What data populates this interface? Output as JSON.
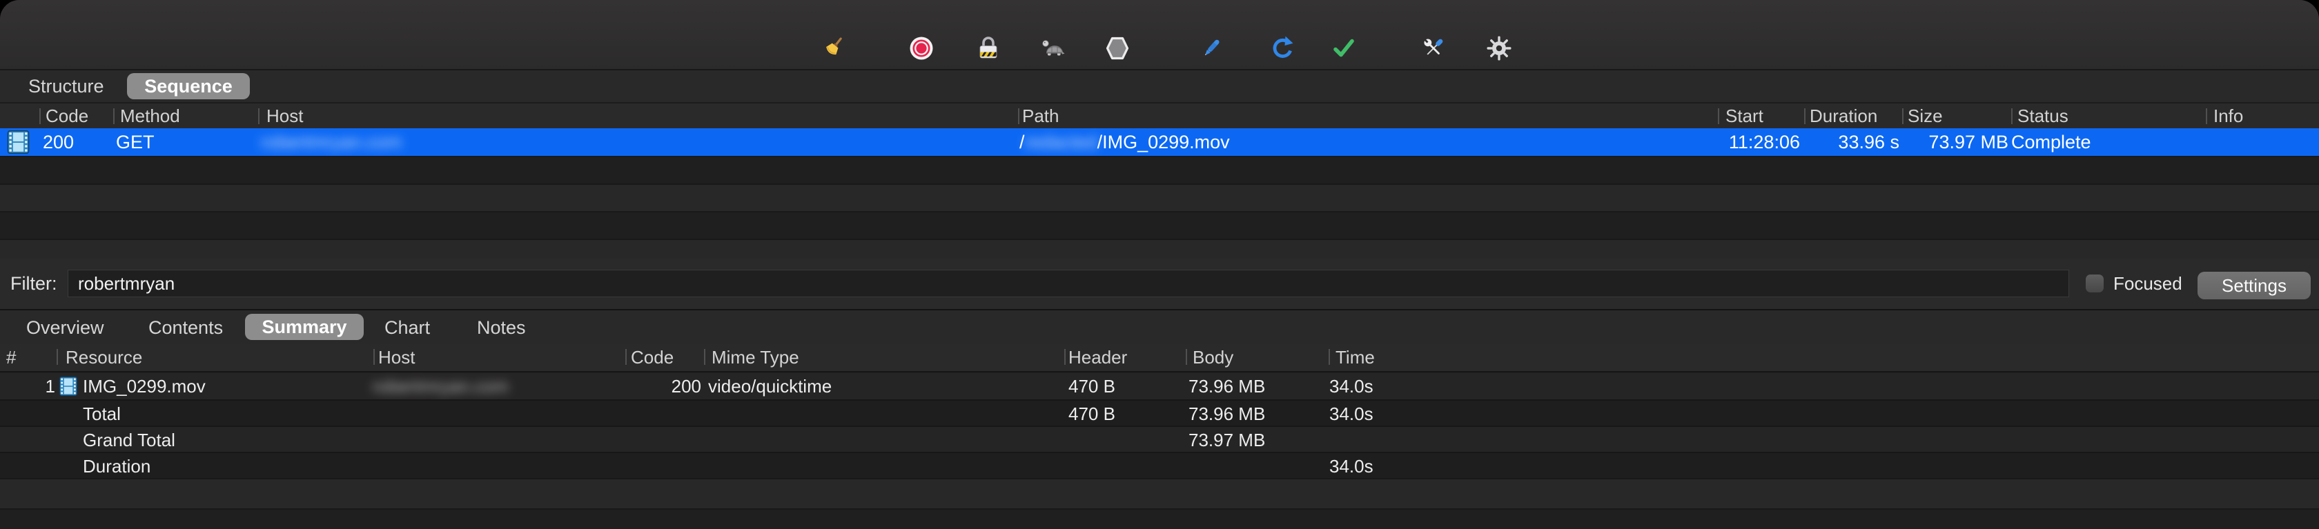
{
  "colors": {
    "selection_blue": "#0c68f3",
    "pill_gray": "#8d8d8d",
    "toolbar_bg": "#2f2e2e",
    "stripe_dark": "#201f1f",
    "stripe_light": "#292828"
  },
  "toolbar": {
    "icons": [
      {
        "name": "clear-broom"
      },
      {
        "name": "record"
      },
      {
        "name": "ssl-proxying-lock"
      },
      {
        "name": "throttle-turtle"
      },
      {
        "name": "breakpoints-hexagon"
      },
      {
        "name": "compose-pen"
      },
      {
        "name": "repeat"
      },
      {
        "name": "validate-check"
      },
      {
        "name": "tools"
      },
      {
        "name": "settings-gear"
      }
    ]
  },
  "sequence_panel": {
    "tabs": [
      {
        "label": "Structure",
        "selected": false
      },
      {
        "label": "Sequence",
        "selected": true
      }
    ],
    "columns": [
      "Code",
      "Method",
      "Host",
      "Path",
      "Start",
      "Duration",
      "Size",
      "Status",
      "Info"
    ],
    "row": {
      "code": "200",
      "method": "GET",
      "host": "robertmryan.com",
      "host_redacted": true,
      "path_prefix": "/",
      "path_redacted": "redacted",
      "path_suffix": "/IMG_0299.mov",
      "start": "11:28:06",
      "duration": "33.96 s",
      "size": "73.97 MB",
      "status": "Complete",
      "info": ""
    }
  },
  "filter_bar": {
    "label": "Filter:",
    "value": "robertmryan",
    "focused_label": "Focused",
    "focused_checked": false,
    "settings_label": "Settings"
  },
  "detail_panel": {
    "tabs": [
      {
        "label": "Overview",
        "selected": false
      },
      {
        "label": "Contents",
        "selected": false
      },
      {
        "label": "Summary",
        "selected": true
      },
      {
        "label": "Chart",
        "selected": false
      },
      {
        "label": "Notes",
        "selected": false
      }
    ],
    "summary_table": {
      "columns": [
        "#",
        "Resource",
        "Host",
        "Code",
        "Mime Type",
        "Header",
        "Body",
        "Time"
      ],
      "rows": [
        {
          "num": "1",
          "resource": "IMG_0299.mov",
          "host": "robertmryan.com",
          "host_redacted": true,
          "code": "200",
          "mime_type": "video/quicktime",
          "header": "470 B",
          "body": "73.96 MB",
          "time": "34.0s"
        },
        {
          "num": "",
          "resource": "Total",
          "host": "",
          "code": "",
          "mime_type": "",
          "header": "470 B",
          "body": "73.96 MB",
          "time": "34.0s"
        },
        {
          "num": "",
          "resource": "Grand Total",
          "host": "",
          "code": "",
          "mime_type": "",
          "header": "",
          "body": "73.97 MB",
          "time": ""
        },
        {
          "num": "",
          "resource": "Duration",
          "host": "",
          "code": "",
          "mime_type": "",
          "header": "",
          "body": "",
          "time": "34.0s"
        }
      ]
    }
  }
}
